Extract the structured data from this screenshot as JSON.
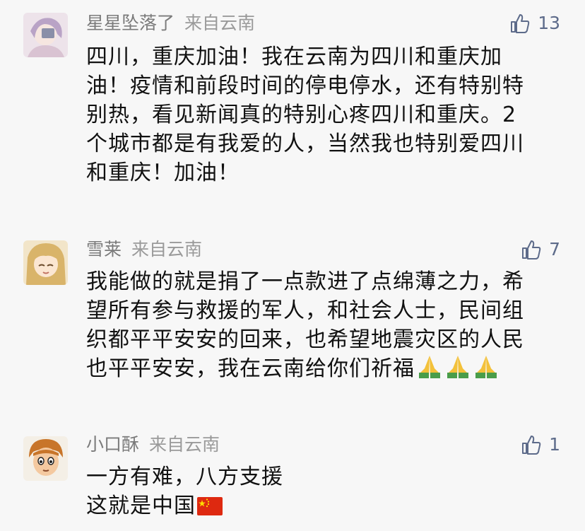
{
  "comments": [
    {
      "username": "星星坠落了",
      "location": "来自云南",
      "likes": "13",
      "lines": [
        "四川，重庆加油！我在云南为四川和重庆加",
        "油！疫情和前段时间的停电停水，还有特别特",
        "别热，看见新闻真的特别心疼四川和重庆。2",
        "个城市都是有我爱的人，当然我也特别爱四川",
        "和重庆！加油！"
      ]
    },
    {
      "username": "雪莱",
      "location": "来自云南",
      "likes": "7",
      "lines": [
        "我能做的就是捐了一点款进了点绵薄之力，希",
        "望所有参与救援的军人，和社会人士，民间组",
        "织都平平安安的回来，也希望地震灾区的人民",
        "也平平安安，我在云南给你们祈福"
      ],
      "trailing_emoji": [
        "folded-hands-emoji",
        "folded-hands-emoji",
        "folded-hands-emoji"
      ]
    },
    {
      "username": "小口酥",
      "location": "来自云南",
      "likes": "1",
      "lines": [
        "一方有难，八方支援",
        "这就是中国"
      ],
      "trailing_emoji": [
        "china-flag-emoji"
      ]
    }
  ],
  "colors": {
    "background": "#f7f7f7",
    "username": "#7b7b7b",
    "like_icon": "#5d6b8a",
    "text": "#111111"
  }
}
